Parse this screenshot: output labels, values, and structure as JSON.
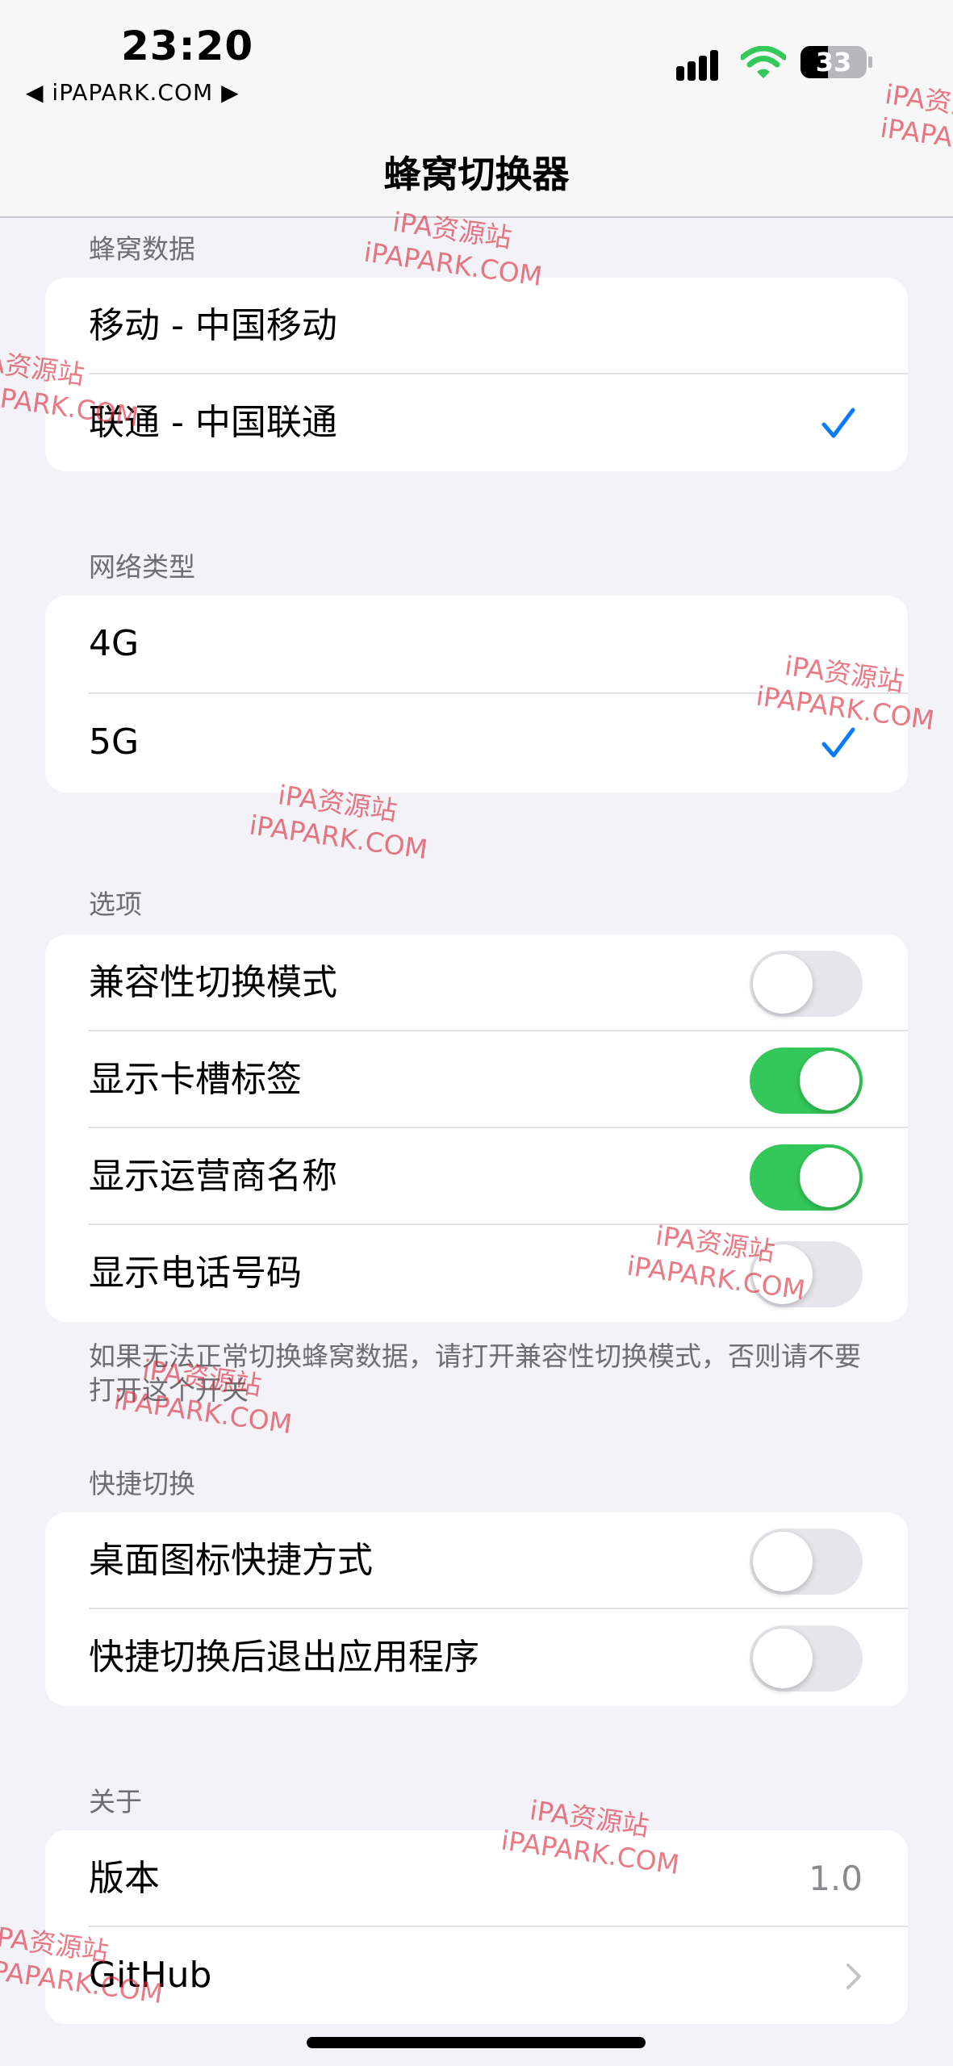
{
  "status_bar": {
    "time": "23:20",
    "back_app": "◀ iPAPARK.COM ▶",
    "battery": "33"
  },
  "nav": {
    "title": "蜂窝切换器"
  },
  "cellular": {
    "header": "蜂窝数据",
    "items": [
      {
        "label": "移动 - 中国移动",
        "selected": false
      },
      {
        "label": "联通 - 中国联通",
        "selected": true
      }
    ]
  },
  "network": {
    "header": "网络类型",
    "items": [
      {
        "label": "4G",
        "selected": false
      },
      {
        "label": "5G",
        "selected": true
      }
    ]
  },
  "options": {
    "header": "选项",
    "items": [
      {
        "label": "兼容性切换模式",
        "on": false
      },
      {
        "label": "显示卡槽标签",
        "on": true
      },
      {
        "label": "显示运营商名称",
        "on": true
      },
      {
        "label": "显示电话号码",
        "on": false
      }
    ],
    "footer": "如果无法正常切换蜂窝数据，请打开兼容性切换模式，否则请不要打开这个开关"
  },
  "shortcuts": {
    "header": "快捷切换",
    "items": [
      {
        "label": "桌面图标快捷方式",
        "on": false
      },
      {
        "label": "快捷切换后退出应用程序",
        "on": false
      }
    ]
  },
  "about": {
    "header": "关于",
    "version_label": "版本",
    "version_value": "1.0",
    "github_label": "GitHub"
  },
  "watermark": {
    "line1": "iPA资源站",
    "line2": "iPAPARK.COM"
  },
  "colors": {
    "accent": "#0a7aff",
    "toggle_on": "#34c759",
    "toggle_off": "#e5e5ea",
    "watermark": "#dc283c"
  }
}
